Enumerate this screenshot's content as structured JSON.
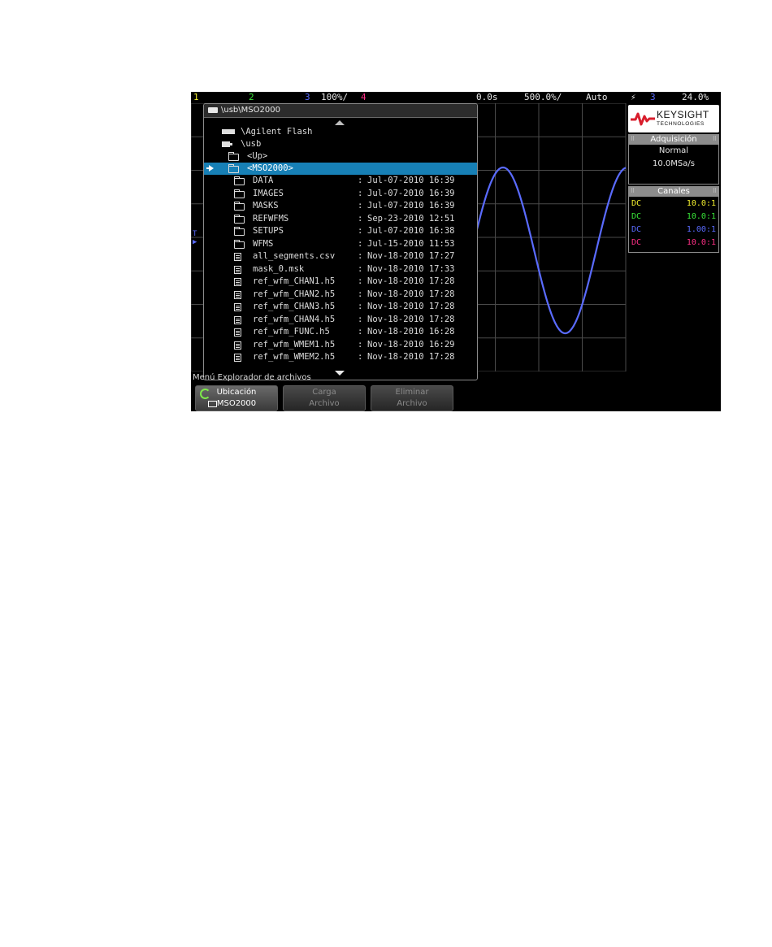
{
  "topbar": {
    "ch1": "1",
    "ch2": "2",
    "ch3": "3",
    "ch3_scale": "100%/",
    "ch4": "4",
    "time_delay": "0.0s",
    "time_scale": "500.0%/",
    "trigger_mode": "Auto",
    "trigger_icon": "rising-edge-icon",
    "trigger_source": "3",
    "trigger_level": "24.0%"
  },
  "file_browser": {
    "path": "\\usb\\MSO2000",
    "entries": [
      {
        "label": "\\Agilent Flash",
        "icon": "drive-icon"
      },
      {
        "label": "\\usb",
        "icon": "usb-icon"
      },
      {
        "label": "<Up>",
        "icon": "folder-up-icon"
      },
      {
        "label": "<MSO2000>",
        "icon": "folder-open-icon",
        "selected": true
      },
      {
        "label": "DATA",
        "icon": "folder-icon",
        "date": "Jul-07-2010 16:39"
      },
      {
        "label": "IMAGES",
        "icon": "folder-icon",
        "date": "Jul-07-2010 16:39"
      },
      {
        "label": "MASKS",
        "icon": "folder-icon",
        "date": "Jul-07-2010 16:39"
      },
      {
        "label": "REFWFMS",
        "icon": "folder-icon",
        "date": "Sep-23-2010 12:51"
      },
      {
        "label": "SETUPS",
        "icon": "folder-icon",
        "date": "Jul-07-2010 16:38"
      },
      {
        "label": "WFMS",
        "icon": "folder-icon",
        "date": "Jul-15-2010 11:53"
      },
      {
        "label": "all_segments.csv",
        "icon": "file-icon",
        "date": "Nov-18-2010 17:27"
      },
      {
        "label": "mask_0.msk",
        "icon": "file-icon",
        "date": "Nov-18-2010 17:33"
      },
      {
        "label": "ref_wfm_CHAN1.h5",
        "icon": "file-icon",
        "date": "Nov-18-2010 17:28"
      },
      {
        "label": "ref_wfm_CHAN2.h5",
        "icon": "file-icon",
        "date": "Nov-18-2010 17:28"
      },
      {
        "label": "ref_wfm_CHAN3.h5",
        "icon": "file-icon",
        "date": "Nov-18-2010 17:28"
      },
      {
        "label": "ref_wfm_CHAN4.h5",
        "icon": "file-icon",
        "date": "Nov-18-2010 17:28"
      },
      {
        "label": "ref_wfm_FUNC.h5",
        "icon": "file-icon",
        "date": "Nov-18-2010 16:28"
      },
      {
        "label": "ref_wfm_WMEM1.h5",
        "icon": "file-icon",
        "date": "Nov-18-2010 16:29"
      },
      {
        "label": "ref_wfm_WMEM2.h5",
        "icon": "file-icon",
        "date": "Nov-18-2010 17:28"
      }
    ]
  },
  "logo": {
    "name": "KEYSIGHT",
    "subtitle": "TECHNOLOGIES"
  },
  "acquisition": {
    "title": "Adquisición",
    "mode": "Normal",
    "rate": "10.0MSa/s"
  },
  "channels": {
    "title": "Canales",
    "rows": [
      {
        "coupling": "DC",
        "probe": "10.0:1",
        "color": "#f2ef2e"
      },
      {
        "coupling": "DC",
        "probe": "10.0:1",
        "color": "#39e639"
      },
      {
        "coupling": "DC",
        "probe": "1.00:1",
        "color": "#5a6bff"
      },
      {
        "coupling": "DC",
        "probe": "10.0:1",
        "color": "#ff2f86"
      }
    ]
  },
  "menu": {
    "title": "Menú Explorador de archivos",
    "softkeys": [
      {
        "line1": "Ubicación",
        "line2": "MSO2000",
        "active": true
      },
      {
        "line1": "Carga",
        "line2": "Archivo",
        "active": false
      },
      {
        "line1": "Eliminar",
        "line2": "Archivo",
        "active": false
      }
    ]
  },
  "colors": {
    "selection": "#1780b6",
    "waveform": "#5a6bff",
    "grid": "#4a4a4a"
  }
}
